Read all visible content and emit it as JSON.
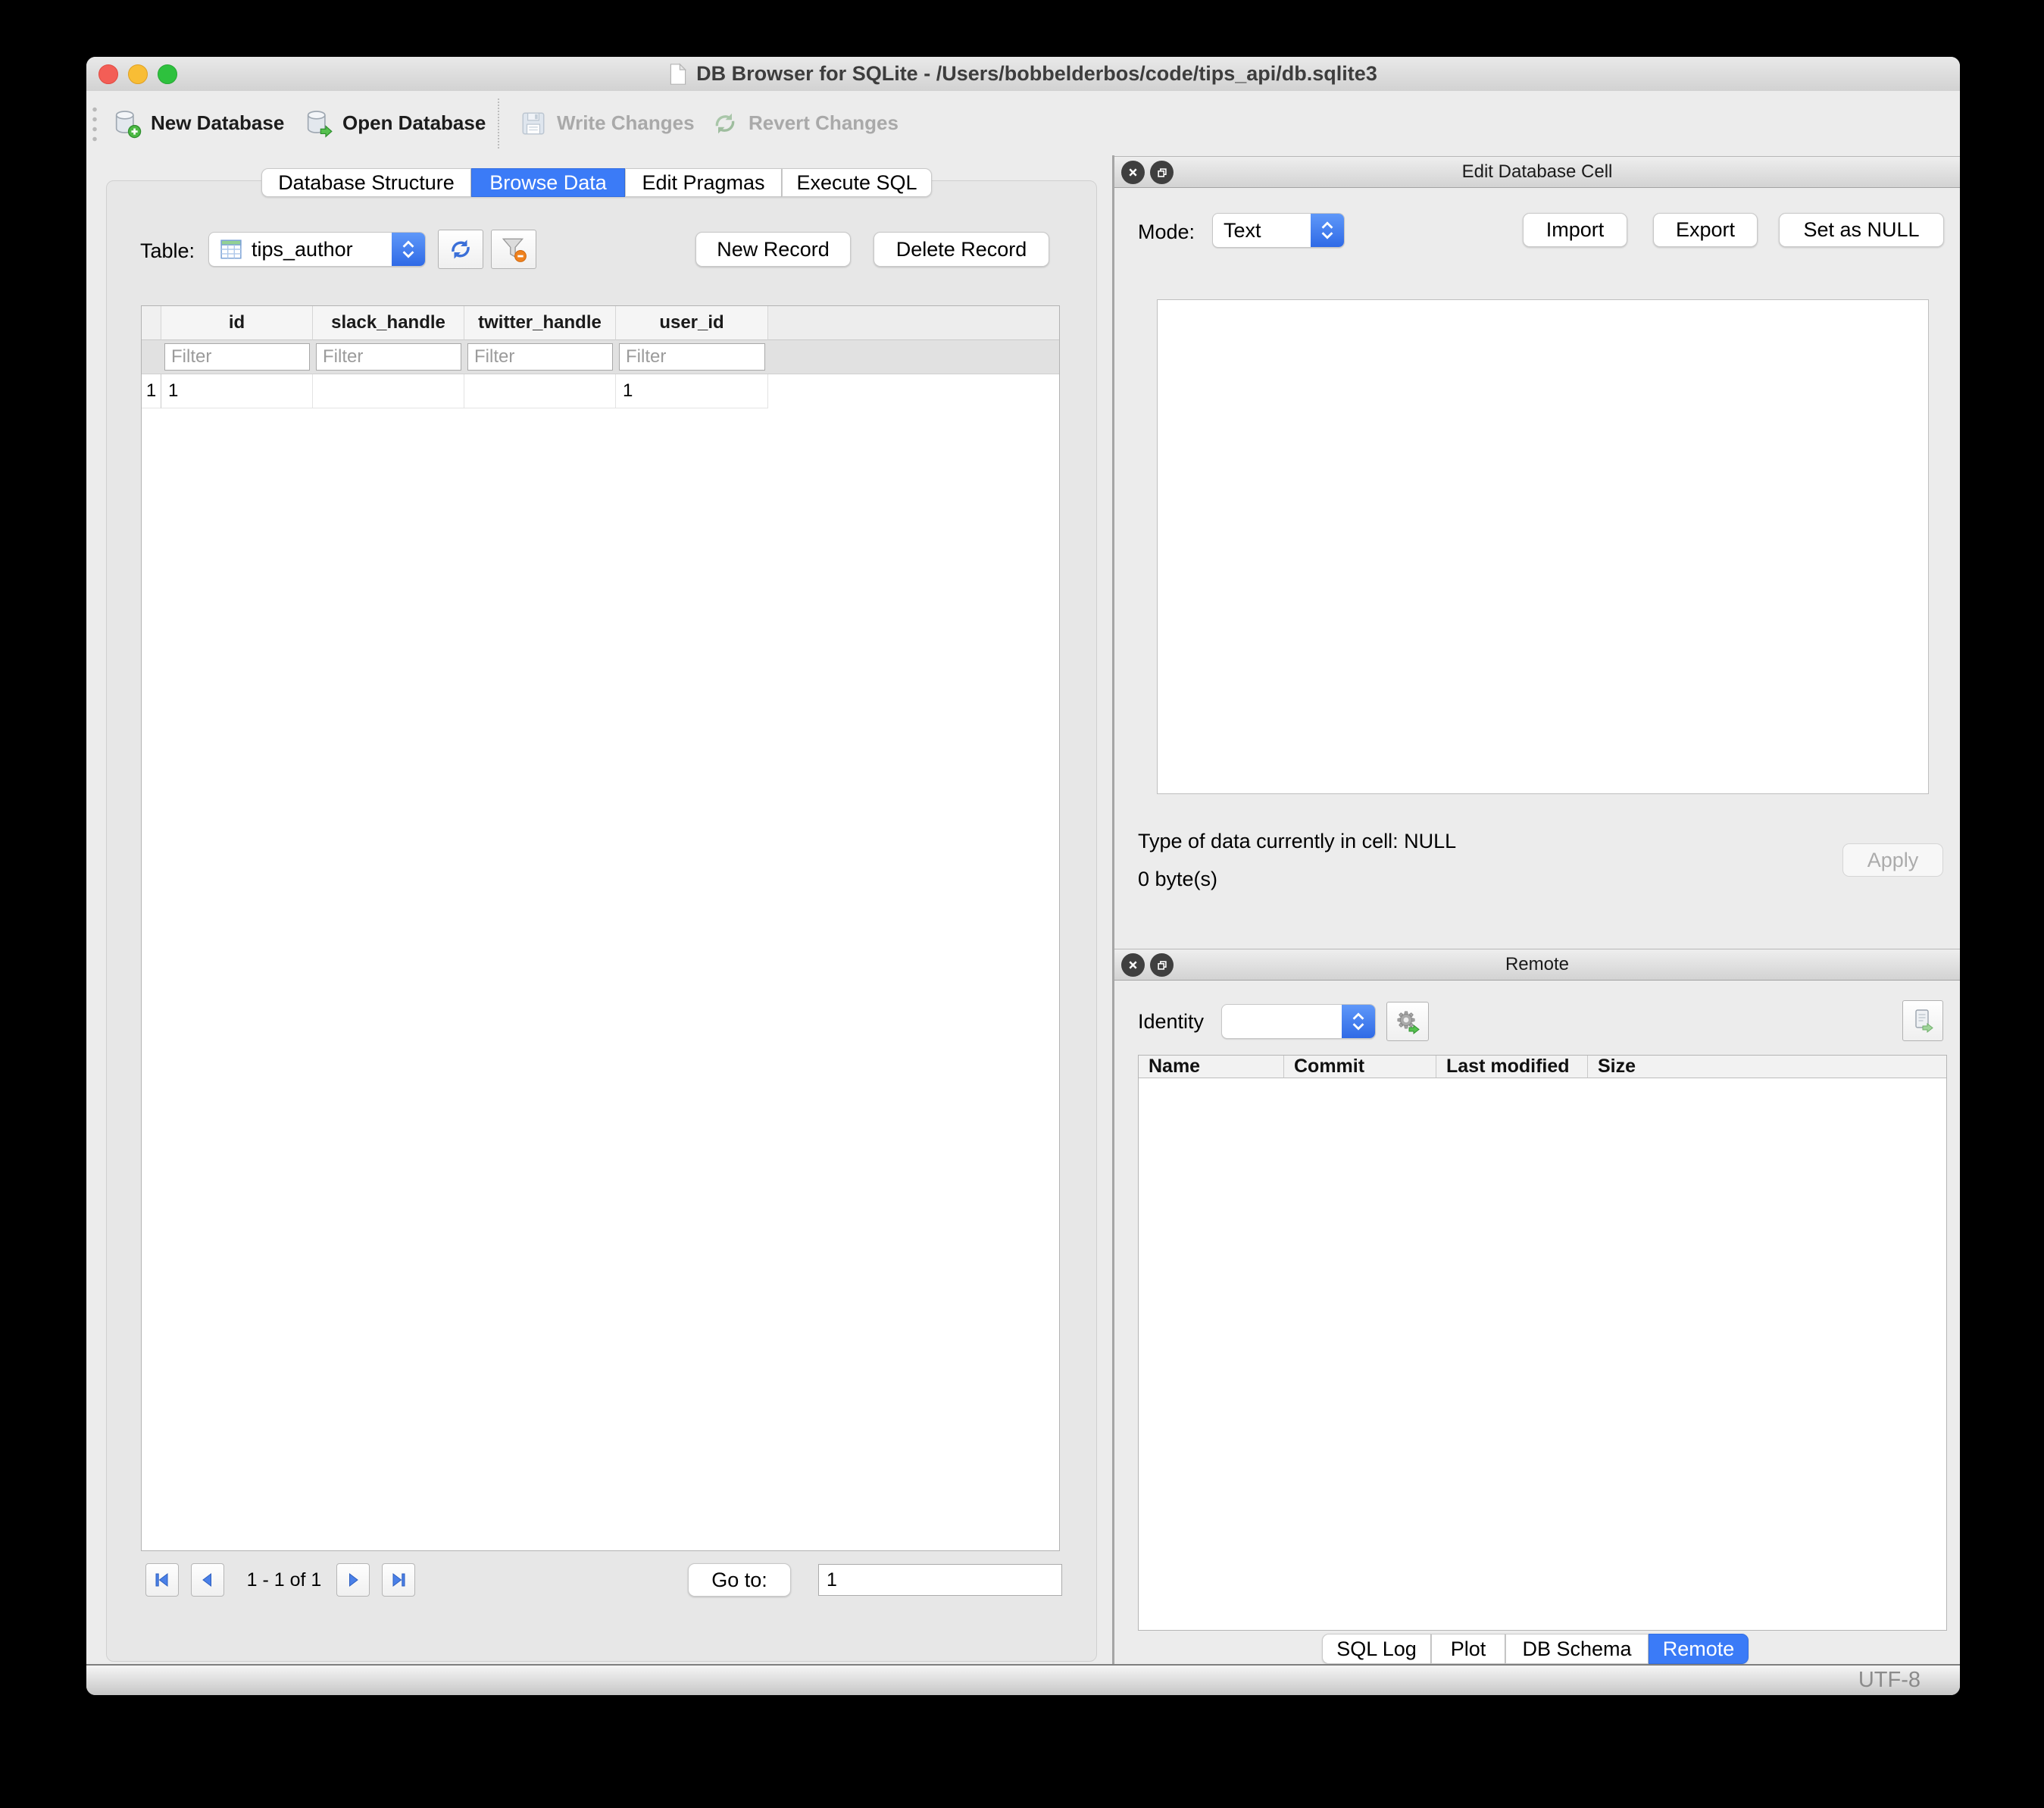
{
  "window_title": "DB Browser for SQLite - /Users/bobbelderbos/code/tips_api/db.sqlite3",
  "toolbar": {
    "new_database": "New Database",
    "open_database": "Open Database",
    "write_changes": "Write Changes",
    "revert_changes": "Revert Changes"
  },
  "main_tabs": [
    {
      "label": "Database Structure",
      "active": false
    },
    {
      "label": "Browse Data",
      "active": true
    },
    {
      "label": "Edit Pragmas",
      "active": false
    },
    {
      "label": "Execute SQL",
      "active": false
    }
  ],
  "browse": {
    "table_label": "Table:",
    "table_value": "tips_author",
    "new_record_label": "New Record",
    "delete_record_label": "Delete Record",
    "grid": {
      "columns": [
        "id",
        "slack_handle",
        "twitter_handle",
        "user_id"
      ],
      "filter_placeholder": "Filter",
      "rows": [
        {
          "num": "1",
          "cells": [
            "1",
            "",
            "",
            "1"
          ]
        }
      ]
    },
    "pagination": {
      "range_label": "1 - 1 of 1",
      "goto_label": "Go to:",
      "goto_value": "1"
    }
  },
  "edit_cell": {
    "title": "Edit Database Cell",
    "mode_label": "Mode:",
    "mode_value": "Text",
    "import_label": "Import",
    "export_label": "Export",
    "set_null_label": "Set as NULL",
    "type_info": "Type of data currently in cell: NULL",
    "size_info": "0 byte(s)",
    "apply_label": "Apply"
  },
  "remote": {
    "title": "Remote",
    "identity_label": "Identity",
    "columns": [
      "Name",
      "Commit",
      "Last modified",
      "Size"
    ]
  },
  "bottom_tabs": [
    {
      "label": "SQL Log",
      "active": false
    },
    {
      "label": "Plot",
      "active": false
    },
    {
      "label": "DB Schema",
      "active": false
    },
    {
      "label": "Remote",
      "active": true
    }
  ],
  "status": {
    "encoding": "UTF-8"
  },
  "colors": {
    "accent_blue": "#3b7bf7",
    "badge_green": "#4cb944",
    "filter_badge_orange": "#f0821e",
    "disabled_text": "#a9a9a9",
    "window_bg": "#ececec"
  },
  "icons": {
    "app_document": "white page with folded corner",
    "new_database": "database cylinder with green plus",
    "open_database": "database cylinder with green arrow",
    "write_changes": "floppy disk (disabled)",
    "revert_changes": "circular arrows (disabled)",
    "table": "table grid with green header",
    "refresh": "blue circular refresh arrows",
    "clear_filter": "funnel with orange minus badge",
    "combo_chevrons": "white up-down chevrons on blue",
    "nav_first": "bar + left triangle",
    "nav_prev": "left triangle",
    "nav_next": "right triangle",
    "nav_last": "right triangle + bar",
    "dock_close": "x in dark circle",
    "dock_float": "overlapping squares in dark circle",
    "identity_settings": "gear with green arrow",
    "push_database": "document with green arrow"
  }
}
